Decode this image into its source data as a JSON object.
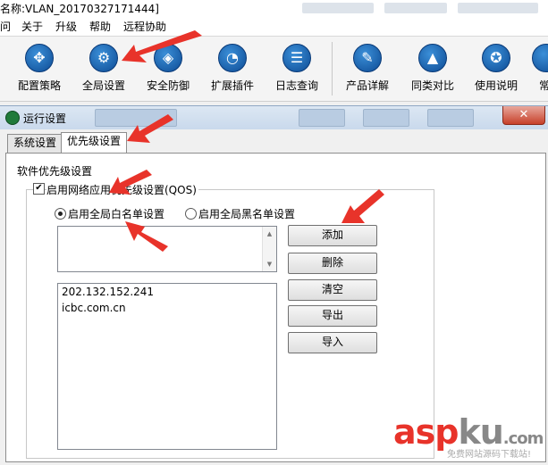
{
  "window": {
    "title": "名称:VLAN_20170327171444]"
  },
  "menu": [
    "问",
    "关于",
    "升级",
    "帮助",
    "远程协助"
  ],
  "toolbar": [
    {
      "label": "配置策略",
      "icon": "arrows-cross-icon"
    },
    {
      "label": "全局设置",
      "icon": "gear-icon"
    },
    {
      "label": "安全防御",
      "icon": "shield-icon"
    },
    {
      "label": "扩展插件",
      "icon": "pie-chart-icon"
    },
    {
      "label": "日志查询",
      "icon": "document-list-icon"
    },
    {
      "label": "产品详解",
      "icon": "notepad-pen-icon"
    },
    {
      "label": "同类对比",
      "icon": "graduation-cap-icon"
    },
    {
      "label": "使用说明",
      "icon": "award-ribbon-icon"
    },
    {
      "label": "常"
    }
  ],
  "dialog": {
    "title": "运行设置",
    "close_glyph": "✕",
    "tabs": [
      "系统设置",
      "优先级设置"
    ],
    "section_label": "软件优先级设置",
    "enable_qos_label": "启用网络应用优先级设置(QOS)",
    "enable_qos_checked": true,
    "whitelist_label": "启用全局白名单设置",
    "blacklist_label": "启用全局黑名单设置",
    "whitelist_selected": true,
    "input_value": "",
    "list_items": [
      "202.132.152.241",
      "icbc.com.cn"
    ],
    "buttons": {
      "add": "添加",
      "delete": "删除",
      "clear": "清空",
      "export": "导出",
      "import": "导入"
    }
  },
  "watermark": {
    "a": "asp",
    "b": "ku",
    "c": ".com",
    "sub": "免费网站源码下载站!"
  },
  "colors": {
    "accent_red": "#e8332a",
    "icon_blue": "#1a5fb4",
    "close_red": "#c7402a"
  }
}
